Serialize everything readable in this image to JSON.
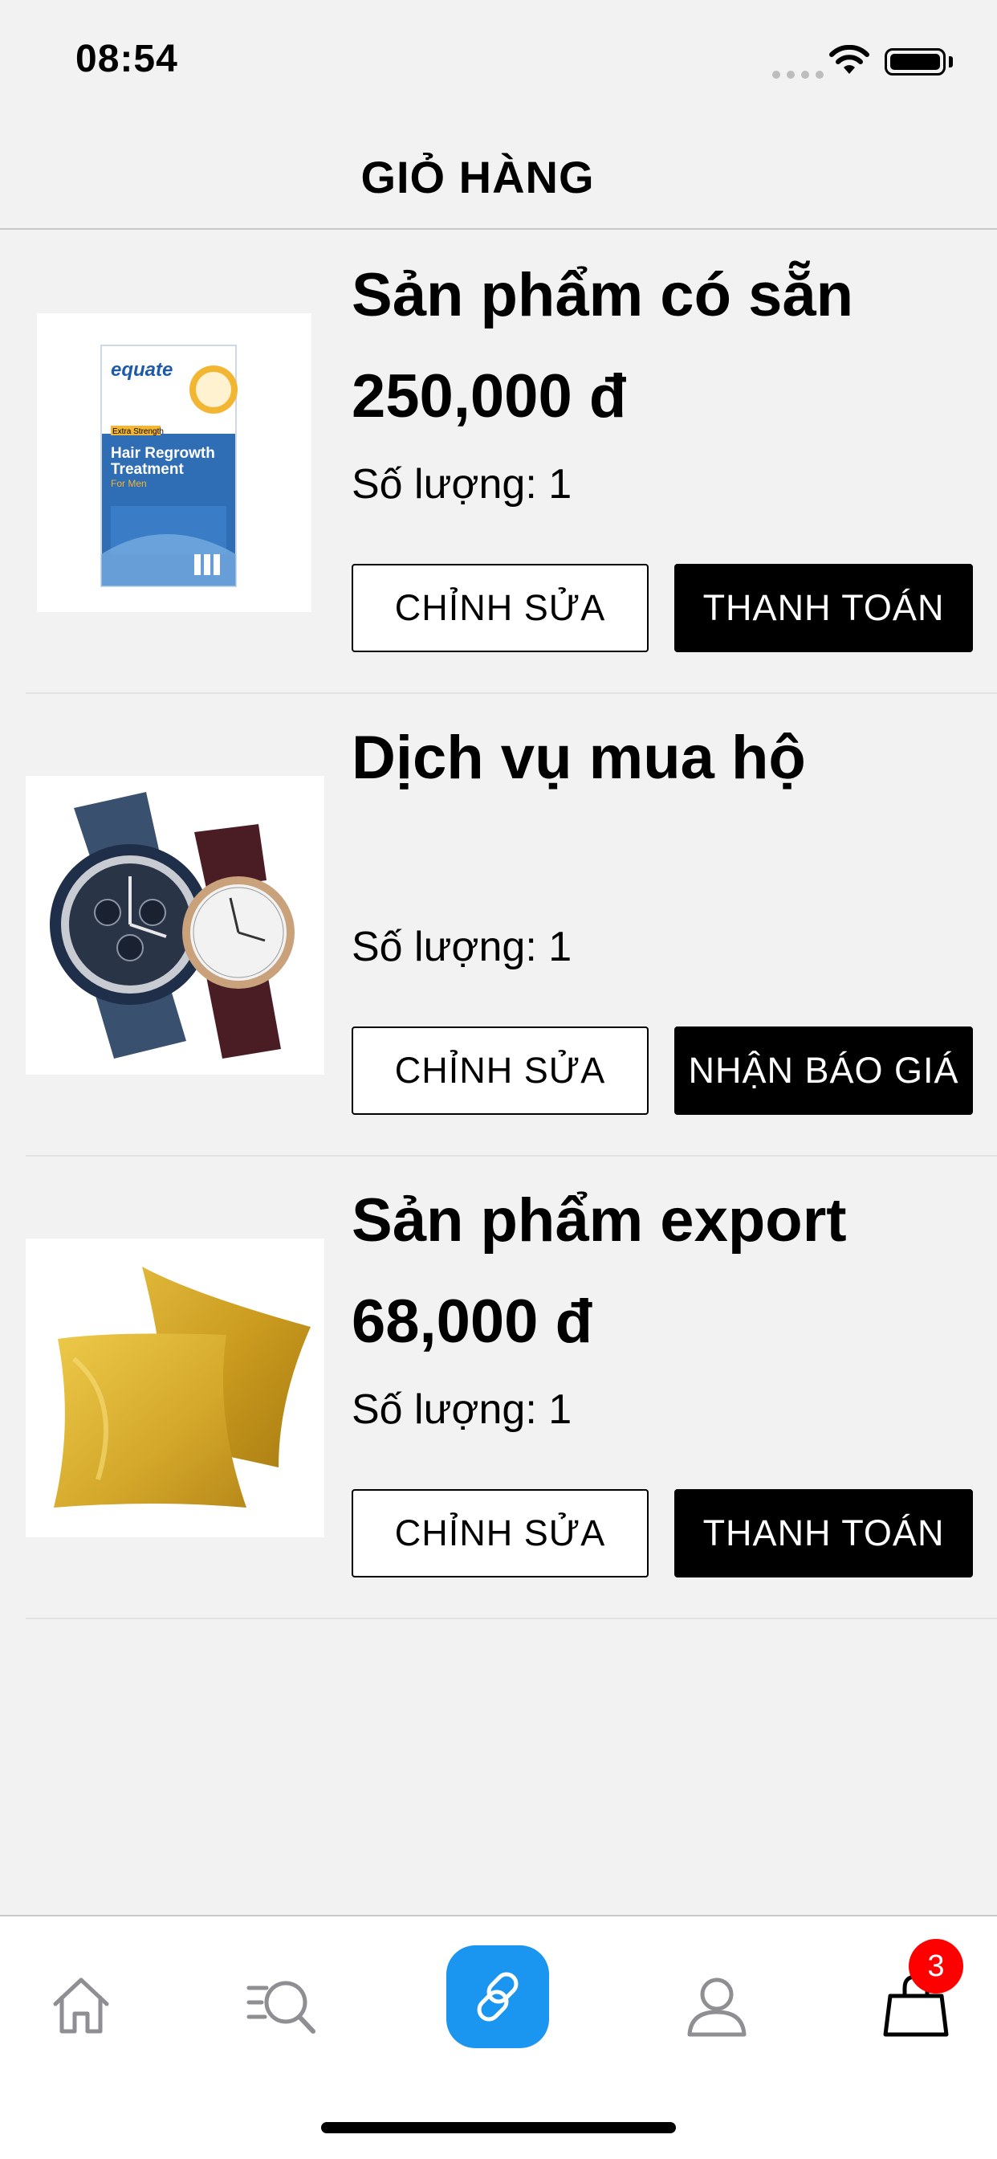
{
  "status": {
    "time": "08:54"
  },
  "header": {
    "title": "GIỎ HÀNG"
  },
  "items": [
    {
      "name": "Sản phẩm có sẵn",
      "price": "250,000 đ",
      "quantity": "Số lượng: 1",
      "edit_label": "CHỈNH SỬA",
      "action_label": "THANH TOÁN",
      "package": {
        "brand": "equate",
        "line1": "Extra Strength",
        "line2": "Hair Regrowth",
        "line3": "Treatment",
        "line4": "For Men"
      }
    },
    {
      "name": "Dịch vụ mua hộ",
      "quantity": "Số lượng: 1",
      "edit_label": "CHỈNH SỬA",
      "action_label": "NHẬN BÁO GIÁ"
    },
    {
      "name": "Sản phẩm export",
      "price": "68,000 đ",
      "quantity": "Số lượng: 1",
      "edit_label": "CHỈNH SỬA",
      "action_label": "THANH TOÁN"
    }
  ],
  "tabbar": {
    "items": [
      {
        "icon": "home-icon"
      },
      {
        "icon": "search-list-icon"
      },
      {
        "icon": "link-icon"
      },
      {
        "icon": "user-icon"
      },
      {
        "icon": "shopping-bag-icon"
      }
    ],
    "cart_badge": "3",
    "accent_color": "#1a96f0",
    "badge_color": "#ff0000"
  }
}
